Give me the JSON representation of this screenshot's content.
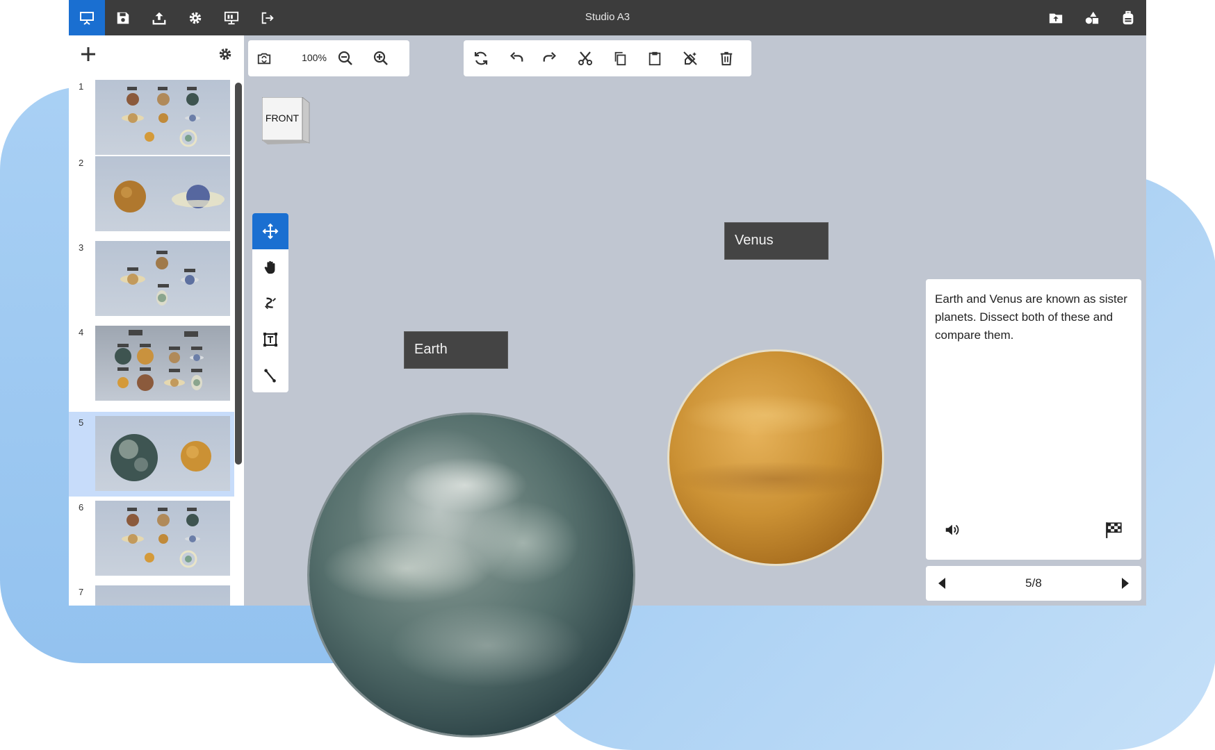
{
  "window": {
    "title": "Studio A3"
  },
  "topbar": {
    "left_icons": [
      "presentation-icon",
      "save-icon",
      "upload-icon",
      "gear-icon",
      "present-screen-icon",
      "exit-icon"
    ],
    "right_icons": [
      "folder-upload-icon",
      "shapes-icon",
      "backpack-icon"
    ]
  },
  "sidebar": {
    "add_icon": "plus-icon",
    "settings_icon": "gear-icon",
    "slides": [
      {
        "number": "1"
      },
      {
        "number": "2"
      },
      {
        "number": "3"
      },
      {
        "number": "4"
      },
      {
        "number": "5",
        "selected": true
      },
      {
        "number": "6"
      },
      {
        "number": "7"
      }
    ]
  },
  "zoombar": {
    "zoom": "100%",
    "icons": [
      "camera-rotate-icon",
      "zoom-out-icon",
      "zoom-in-icon"
    ]
  },
  "editbar": {
    "icons": [
      "refresh-icon",
      "undo-icon",
      "redo-icon",
      "cut-icon",
      "copy-icon",
      "paste-icon",
      "clear-icon",
      "delete-icon"
    ]
  },
  "viewcube": {
    "face": "FRONT"
  },
  "tools": {
    "icons": [
      "move-icon",
      "hand-icon",
      "path-icon",
      "text-box-icon",
      "line-icon"
    ],
    "active": "move-icon"
  },
  "scene": {
    "labels": {
      "earth": "Earth",
      "venus": "Venus"
    }
  },
  "description": {
    "text": "Earth and Venus are known as sister planets. Dissect both of these and compare them.",
    "icons": [
      "speaker-icon",
      "checkered-flag-icon"
    ]
  },
  "nav": {
    "page": "5/8"
  },
  "colors": {
    "accent": "#1a6fd1",
    "topbar": "#3c3c3c",
    "canvas": "#c0c6d1",
    "selected_slide": "#c7dcfa"
  }
}
